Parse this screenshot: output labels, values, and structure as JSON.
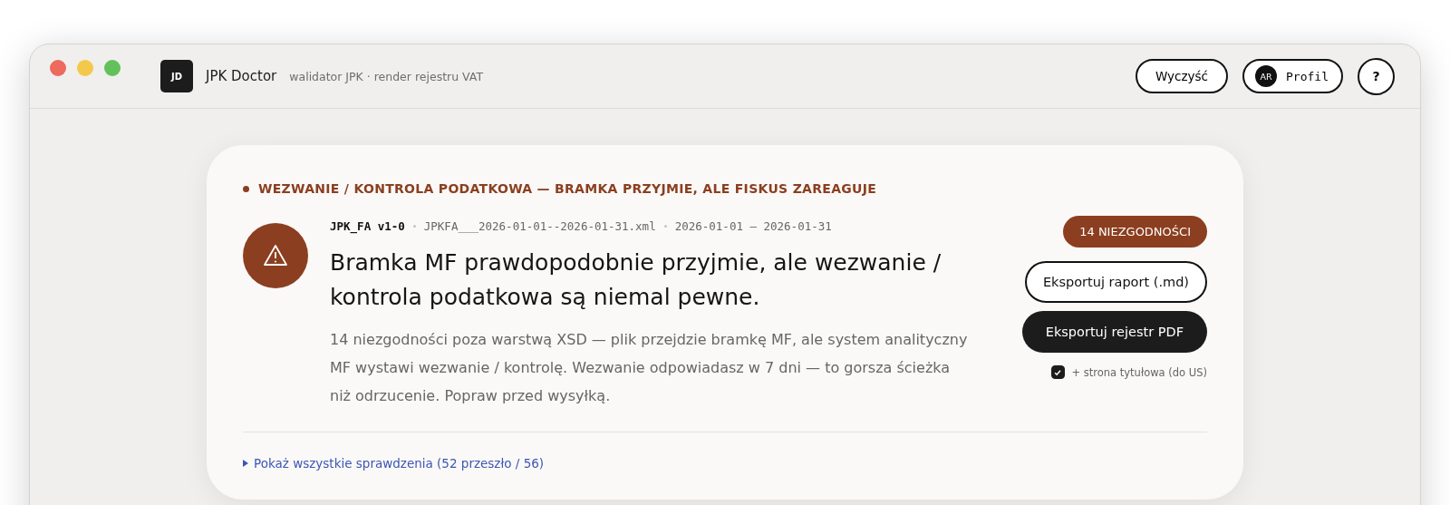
{
  "window": {
    "title": "JPK Doctor",
    "logo": "JD",
    "subtitle": "walidator JPK · render rejestru VAT"
  },
  "toolbar": {
    "clear_button": "Wyczyść",
    "profile": {
      "initials": "AR",
      "label": "Profil"
    },
    "help_button": "?"
  },
  "result": {
    "status": "WEZWANIE / KONTROLA PODATKOWA — BRAMKA PRZYJMIE, ALE FISKUS ZAREAGUJE",
    "meta": [
      "JPK_FA v1-0",
      "JPKFA___2026-01-01--2026-01-31.xml",
      "2026-01-01 — 2026-01-31"
    ],
    "headline": "Bramka MF prawdopodobnie przyjmie, ale wezwanie / kontrola podatkowa są niemal pewne.",
    "description": "14 niezgodności poza warstwą XSD — plik przejdzie bramkę MF, ale system analityczny MF wystawi wezwanie / kontrolę. Wezwanie odpowiadasz w 7 dni — to gorsza ścieżka niż odrzucenie. Popraw przed wysyłką.",
    "badge": "14 NIEZGODNOŚCI",
    "export_report_button": "Eksportuj raport (.md)",
    "export_pdf_button": "Eksportuj rejestr PDF",
    "title_page_option": {
      "label": "+ strona tytułowa (do US)",
      "checked": true
    },
    "show_checks": {
      "label": "Pokaż wszystkie sprawdzenia (52 przeszło / 56)",
      "expanded": false
    }
  }
}
